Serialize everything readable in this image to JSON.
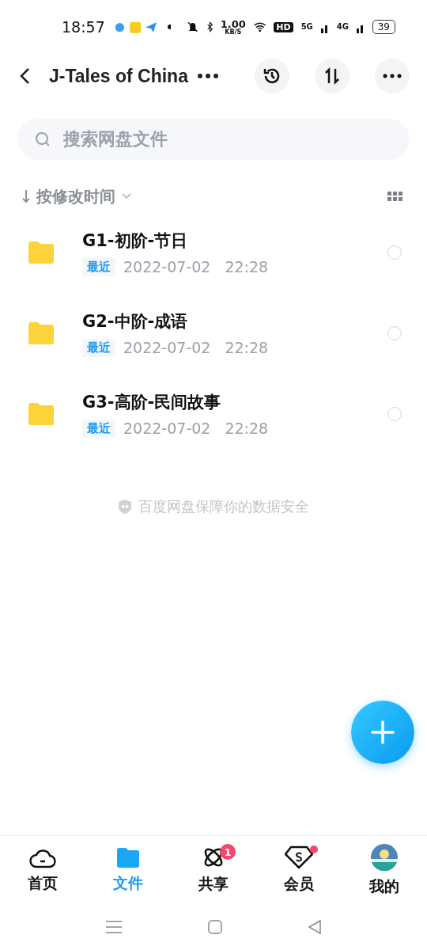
{
  "status_bar": {
    "time": "18:57",
    "speed": "1.00",
    "speed_unit": "KB/S",
    "hd": "HD",
    "sim1": "5G",
    "sim2": "4G",
    "battery": "39"
  },
  "header": {
    "title": "J-Tales of China"
  },
  "search": {
    "placeholder": "搜索网盘文件"
  },
  "sort": {
    "label": "按修改时间"
  },
  "files": [
    {
      "name": "G1-初阶-节日",
      "tag": "最近",
      "date": "2022-07-02",
      "time": "22:28",
      "selected": false
    },
    {
      "name": "G2-中阶-成语",
      "tag": "最近",
      "date": "2022-07-02",
      "time": "22:28",
      "selected": false
    },
    {
      "name": "G3-高阶-民间故事",
      "tag": "最近",
      "date": "2022-07-02",
      "time": "22:28",
      "selected": false
    }
  ],
  "footer_note": "百度网盘保障你的数据安全",
  "tabs": [
    {
      "kind": "home",
      "label": "首页",
      "selected": false
    },
    {
      "kind": "files",
      "label": "文件",
      "selected": true
    },
    {
      "kind": "share",
      "label": "共享",
      "selected": false,
      "badge": "1"
    },
    {
      "kind": "vip",
      "label": "会员",
      "selected": false,
      "dot": true
    },
    {
      "kind": "me",
      "label": "我的",
      "selected": false
    }
  ]
}
